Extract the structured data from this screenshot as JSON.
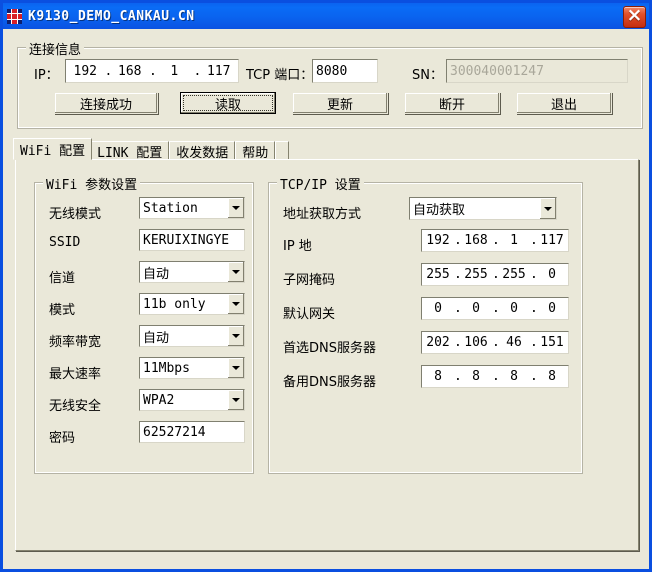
{
  "window": {
    "title": "K9130_DEMO_CANKAU.CN",
    "close_label": "×",
    "icon": "flag-cross-icon",
    "titlebar_color": "#0a63ef",
    "client_color": "#eae8d9"
  },
  "connection_group": {
    "caption": "连接信息",
    "ip_label": "IP：",
    "ip_value": [
      "192",
      "168",
      "1",
      "117"
    ],
    "port_label": "TCP 端口：",
    "port_value": "8080",
    "sn_label": "SN：",
    "sn_value": "300040001247",
    "sn_disabled": true,
    "buttons": [
      {
        "label": "连接成功",
        "focused": false
      },
      {
        "label": "读取",
        "focused": true
      },
      {
        "label": "更新",
        "focused": false
      },
      {
        "label": "断开",
        "focused": false
      },
      {
        "label": "退出",
        "focused": false
      }
    ]
  },
  "tabs": [
    {
      "label": "WiFi 配置",
      "active": true
    },
    {
      "label": "LINK 配置",
      "active": false
    },
    {
      "label": "收发数据",
      "active": false
    },
    {
      "label": "帮助",
      "active": false
    }
  ],
  "wifi_group": {
    "caption": "WiFi 参数设置",
    "rows": [
      {
        "label": "无线模式",
        "type": "combo",
        "value": "Station"
      },
      {
        "label": "SSID",
        "type": "text",
        "value": "KERUIXINGYE"
      },
      {
        "label": "信道",
        "type": "combo",
        "value": "自动"
      },
      {
        "label": "模式",
        "type": "combo",
        "value": "11b only"
      },
      {
        "label": "频率带宽",
        "type": "combo",
        "value": "自动"
      },
      {
        "label": "最大速率",
        "type": "combo",
        "value": "11Mbps"
      },
      {
        "label": "无线安全",
        "type": "combo",
        "value": "WPA2"
      },
      {
        "label": "密码",
        "type": "text",
        "value": "62527214"
      }
    ]
  },
  "tcpip_group": {
    "caption": "TCP/IP 设置",
    "mode_label": "地址获取方式",
    "mode_value": "自动获取",
    "rows": [
      {
        "label": "IP 地",
        "octets": [
          "192",
          "168",
          "1",
          "117"
        ]
      },
      {
        "label": "子网掩码",
        "octets": [
          "255",
          "255",
          "255",
          "0"
        ]
      },
      {
        "label": "默认网关",
        "octets": [
          "0",
          "0",
          "0",
          "0"
        ]
      },
      {
        "label": "首选DNS服务器",
        "octets": [
          "202",
          "106",
          "46",
          "151"
        ]
      },
      {
        "label": "备用DNS服务器",
        "octets": [
          "8",
          "8",
          "8",
          "8"
        ]
      }
    ]
  }
}
